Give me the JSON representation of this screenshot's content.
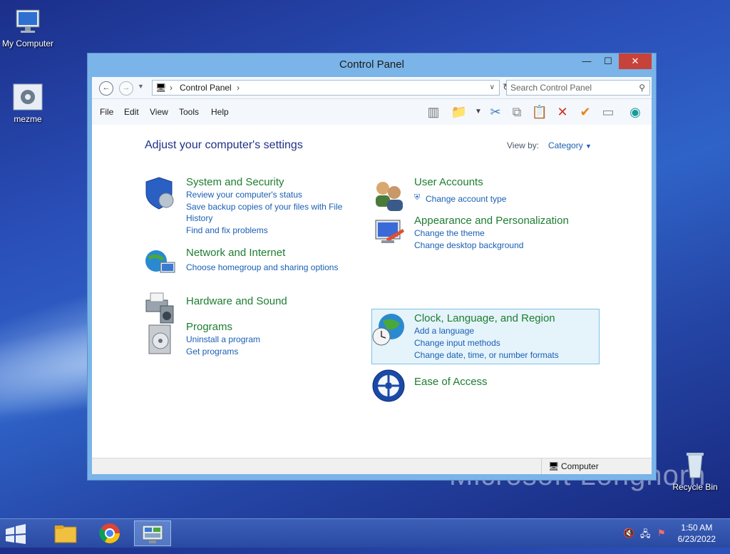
{
  "desktop": {
    "icons": [
      {
        "label": "My Computer"
      },
      {
        "label": "mezme"
      },
      {
        "label": "Recycle Bin"
      }
    ]
  },
  "window": {
    "title": "Control Panel",
    "controls": {
      "minimize": "—",
      "maximize": "☐",
      "close": "✕"
    },
    "address": {
      "path": "Control Panel",
      "search_placeholder": "Search Control Panel"
    },
    "menu": [
      "File",
      "Edit",
      "View",
      "Tools",
      "Help"
    ],
    "heading": "Adjust your computer's settings",
    "view_by_label": "View by:",
    "view_by_value": "Category",
    "categories": {
      "system": {
        "title": "System and Security",
        "links": [
          "Review your computer's status",
          "Save backup copies of your files with File",
          "History",
          "Find and fix problems"
        ]
      },
      "network": {
        "title": "Network and Internet",
        "links": [
          "Choose homegroup and sharing options"
        ]
      },
      "hardware": {
        "title": "Hardware and Sound"
      },
      "programs": {
        "title": "Programs",
        "links": [
          "Uninstall a program",
          "Get programs"
        ]
      },
      "users": {
        "title": "User Accounts",
        "links": [
          "Change account type"
        ]
      },
      "appearance": {
        "title": "Appearance and Personalization",
        "links": [
          "Change the theme",
          "Change desktop background"
        ]
      },
      "clock": {
        "title": "Clock, Language, and Region",
        "links": [
          "Add a language",
          "Change input methods",
          "Change date, time, or number formats"
        ]
      },
      "ease": {
        "title": "Ease of Access"
      }
    },
    "status": "Computer"
  },
  "taskbar": {
    "time": "1:50 AM",
    "date": "6/23/2022"
  },
  "colors": {
    "accent": "#1a5fb4",
    "category_title": "#1e7d32",
    "heading": "#1e3287",
    "close_button": "#c7423a"
  }
}
